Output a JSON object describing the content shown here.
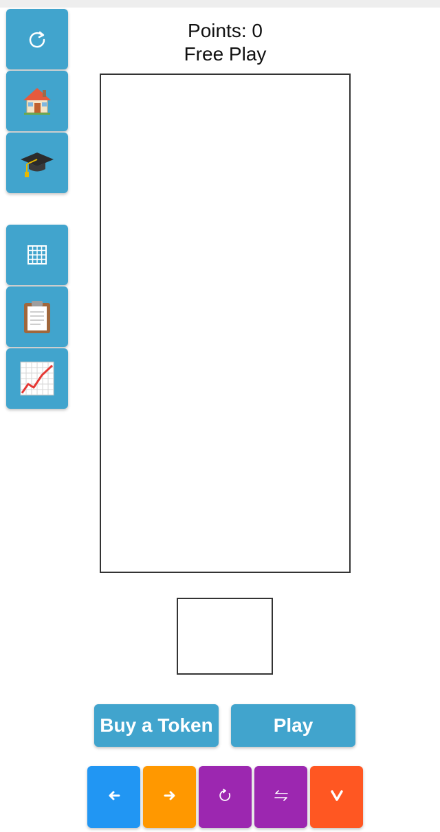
{
  "header": {
    "points_label": "Points: 0",
    "mode_label": "Free Play"
  },
  "sidebar": {
    "buttons": [
      {
        "name": "restart",
        "icon": "restart-icon"
      },
      {
        "name": "home",
        "icon": "house-icon"
      },
      {
        "name": "tutorial",
        "icon": "graduation-cap-icon"
      },
      {
        "name": "grid",
        "icon": "grid-icon"
      },
      {
        "name": "clipboard",
        "icon": "clipboard-icon"
      },
      {
        "name": "stats",
        "icon": "chart-increasing-icon"
      }
    ],
    "color": "#41a4cd"
  },
  "actions": {
    "buy_token_label": "Buy a Token",
    "play_label": "Play",
    "color": "#41a4cd"
  },
  "controls": [
    {
      "name": "move-left",
      "glyph": "←",
      "color": "#2196f3"
    },
    {
      "name": "move-right",
      "glyph": "→",
      "color": "#ff9800"
    },
    {
      "name": "rotate",
      "glyph": "↻",
      "color": "#9c27b0"
    },
    {
      "name": "flip",
      "glyph": "⇋",
      "color": "#9c27b0"
    },
    {
      "name": "drop",
      "glyph": "V",
      "color": "#ff5722"
    }
  ]
}
